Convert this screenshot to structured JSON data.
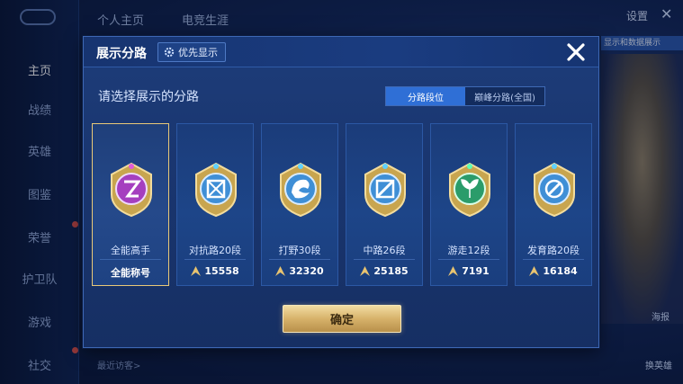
{
  "background": {
    "sidebar": [
      "主页",
      "战绩",
      "英雄",
      "图鉴",
      "荣誉",
      "护卫队",
      "游戏",
      "社交"
    ],
    "tabs": [
      "个人主页",
      "电竞生涯"
    ],
    "settings_label": "设置",
    "close_label": "✕",
    "banner_text": "显示和数据展示",
    "right_buttons": [
      "海报",
      "换英雄"
    ],
    "bottom_text": "最近访客>"
  },
  "modal": {
    "title": "展示分路",
    "priority_label": "优先显示",
    "subtitle": "请选择展示的分路",
    "toggle": [
      "分路段位",
      "巅峰分路(全国)"
    ],
    "cards": [
      {
        "lane": "全能高手",
        "score": "全能称号",
        "selected": true,
        "color": "#a53fbf"
      },
      {
        "lane": "对抗路20段",
        "score": "15558",
        "selected": false,
        "color": "#3f8fd6"
      },
      {
        "lane": "打野30段",
        "score": "32320",
        "selected": false,
        "color": "#3f8fd6"
      },
      {
        "lane": "中路26段",
        "score": "25185",
        "selected": false,
        "color": "#3f8fd6"
      },
      {
        "lane": "游走12段",
        "score": "7191",
        "selected": false,
        "color": "#2b9c6a"
      },
      {
        "lane": "发育路20段",
        "score": "16184",
        "selected": false,
        "color": "#3f8fd6"
      }
    ],
    "confirm_label": "确定"
  }
}
